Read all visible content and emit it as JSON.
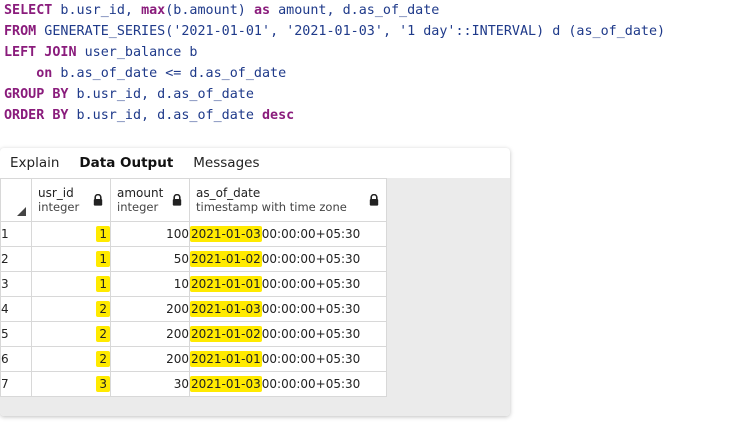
{
  "sql": {
    "line1": {
      "k1": "SELECT",
      "t1": " b.usr_id, ",
      "k2": "max",
      "t2": "(b.amount) ",
      "k3": "as",
      "t3": " amount, d.as_of_date"
    },
    "line2": {
      "k1": "FROM",
      "t1": " GENERATE_SERIES(",
      "s1": "'2021-01-01'",
      "t2": ", ",
      "s2": "'2021-01-03'",
      "t3": ", ",
      "s3": "'1 day'",
      "t4": "::INTERVAL) d (as_of_date)"
    },
    "line3": {
      "k1": "LEFT JOIN",
      "t1": " user_balance b"
    },
    "line4": {
      "k1": "on",
      "t1": " b.as_of_date <= d.as_of_date"
    },
    "line5": {
      "k1": "GROUP BY",
      "t1": " b.usr_id, d.as_of_date"
    },
    "line6": {
      "k1": "ORDER BY",
      "t1": " b.usr_id, d.as_of_date ",
      "k2": "desc"
    }
  },
  "tabs": [
    {
      "label": "Explain"
    },
    {
      "label": "Data Output"
    },
    {
      "label": "Messages"
    }
  ],
  "columns": [
    {
      "name": "usr_id",
      "type": "integer"
    },
    {
      "name": "amount",
      "type": "integer"
    },
    {
      "name": "as_of_date",
      "type": "timestamp with time zone"
    }
  ],
  "rows": [
    {
      "n": "1",
      "usr_id": "1",
      "amount": "100",
      "date": "2021-01-03",
      "time": "00:00:00+05:30"
    },
    {
      "n": "2",
      "usr_id": "1",
      "amount": "50",
      "date": "2021-01-02",
      "time": "00:00:00+05:30"
    },
    {
      "n": "3",
      "usr_id": "1",
      "amount": "10",
      "date": "2021-01-01",
      "time": "00:00:00+05:30"
    },
    {
      "n": "4",
      "usr_id": "2",
      "amount": "200",
      "date": "2021-01-03",
      "time": "00:00:00+05:30"
    },
    {
      "n": "5",
      "usr_id": "2",
      "amount": "200",
      "date": "2021-01-02",
      "time": "00:00:00+05:30"
    },
    {
      "n": "6",
      "usr_id": "2",
      "amount": "200",
      "date": "2021-01-01",
      "time": "00:00:00+05:30"
    },
    {
      "n": "7",
      "usr_id": "3",
      "amount": "30",
      "date": "2021-01-03",
      "time": "00:00:00+05:30"
    }
  ],
  "colors": {
    "highlight": "#ffea00",
    "keyword": "#8a1c7c",
    "code": "#1f3a8a"
  }
}
